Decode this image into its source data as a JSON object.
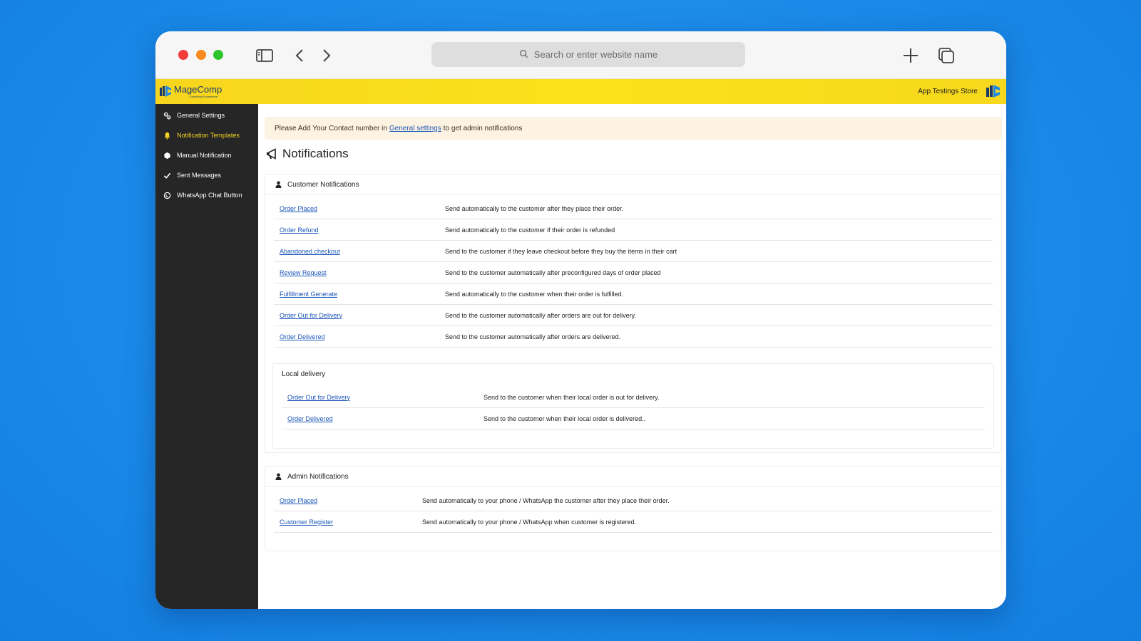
{
  "browser": {
    "address_placeholder": "Search or enter website name"
  },
  "brand": {
    "logo_text": "MageComp",
    "logo_tagline": "Enriching Ecommerce",
    "store_name": "App Testings Store",
    "accent": "#f7d51e"
  },
  "sidebar": {
    "items": [
      {
        "label": "General Settings",
        "icon": "gear-icon",
        "active": false
      },
      {
        "label": "Notification Templates",
        "icon": "bell-icon",
        "active": true
      },
      {
        "label": "Manual Notification",
        "icon": "hexagon-icon",
        "active": false
      },
      {
        "label": "Sent Messages",
        "icon": "check-icon",
        "active": false
      },
      {
        "label": "WhatsApp Chat Button",
        "icon": "whatsapp-icon",
        "active": false
      }
    ]
  },
  "alert": {
    "before": "Please Add Your Contact number in",
    "link": "General settings",
    "after": "to get admin notifications"
  },
  "page_title": "Notifications",
  "customer": {
    "title": "Customer Notifications",
    "rows": [
      {
        "name": "Order Placed",
        "desc": "Send automatically to the customer after they place their order."
      },
      {
        "name": "Order Refund",
        "desc": "Send automatically to the customer if their order is refunded"
      },
      {
        "name": "Abandoned checkout",
        "desc": "Send to the customer if they leave checkout before they buy the items in their cart"
      },
      {
        "name": "Review Request",
        "desc": "Send to the customer automatically after preconfigured days of order placed"
      },
      {
        "name": "Fulfillment Generate",
        "desc": "Send automatically to the customer when their order is fulfilled."
      },
      {
        "name": "Order Out for Delivery",
        "desc": "Send to the customer automatically after orders are out for delivery."
      },
      {
        "name": "Order Delivered",
        "desc": "Send to the customer automatically after orders are delivered."
      }
    ],
    "local_delivery": {
      "title": "Local delivery",
      "rows": [
        {
          "name": "Order Out for Delivery",
          "desc": "Send to the customer when their local order is out for delivery."
        },
        {
          "name": "Order Delivered",
          "desc": "Send to the customer when their local order is delivered.."
        }
      ]
    }
  },
  "admin": {
    "title": "Admin Notifications",
    "rows": [
      {
        "name": "Order Placed",
        "desc": "Send automatically to your phone / WhatsApp the customer after they place their order."
      },
      {
        "name": "Customer Register",
        "desc": "Send automatically to your phone / WhatsApp when customer is registered."
      }
    ]
  }
}
